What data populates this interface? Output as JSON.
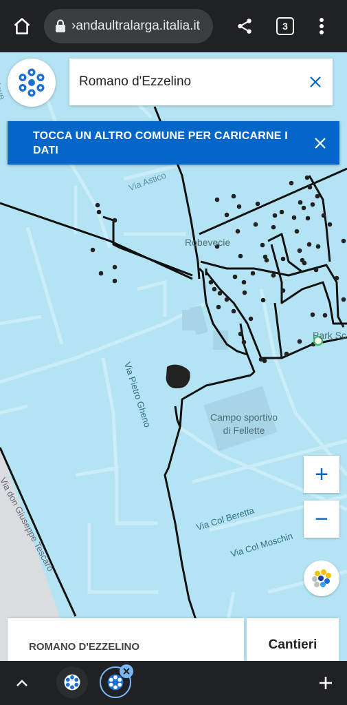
{
  "browser": {
    "url": "›andaultralarga.italia.it",
    "tab_count": "3",
    "icons": [
      "home-icon",
      "lock-icon",
      "share-icon",
      "tab-switcher-icon",
      "more-vert-icon"
    ]
  },
  "search": {
    "value": "Romano d'Ezzelino"
  },
  "banner": {
    "text": "TOCCA UN ALTRO COMUNE PER CARICARNE I DATI"
  },
  "map": {
    "labels": {
      "via_astico": "Via Astico",
      "robevecie": "Robevecie",
      "park": "Park Sc",
      "via_pietro": "Via Pietro Gheno",
      "campo_line1": "Campo sportivo",
      "campo_line2": "di Fellette",
      "via_col_beretta": "Via Col Beretta",
      "via_col_moschin": "Via Col Moschin",
      "via_don": "Via don Giuseppe Tescaro",
      "piave": "Piave"
    }
  },
  "controls": {
    "zoom_in": "+",
    "zoom_out": "−"
  },
  "panel": {
    "comune": "ROMANO D'EZZELINO",
    "tab_label": "Cantieri"
  },
  "colors": {
    "banner": "#0466c8",
    "map_water": "#b4e3f3",
    "logo_blue": "#1a6fd0",
    "pin_green": "#3fbf6b"
  }
}
